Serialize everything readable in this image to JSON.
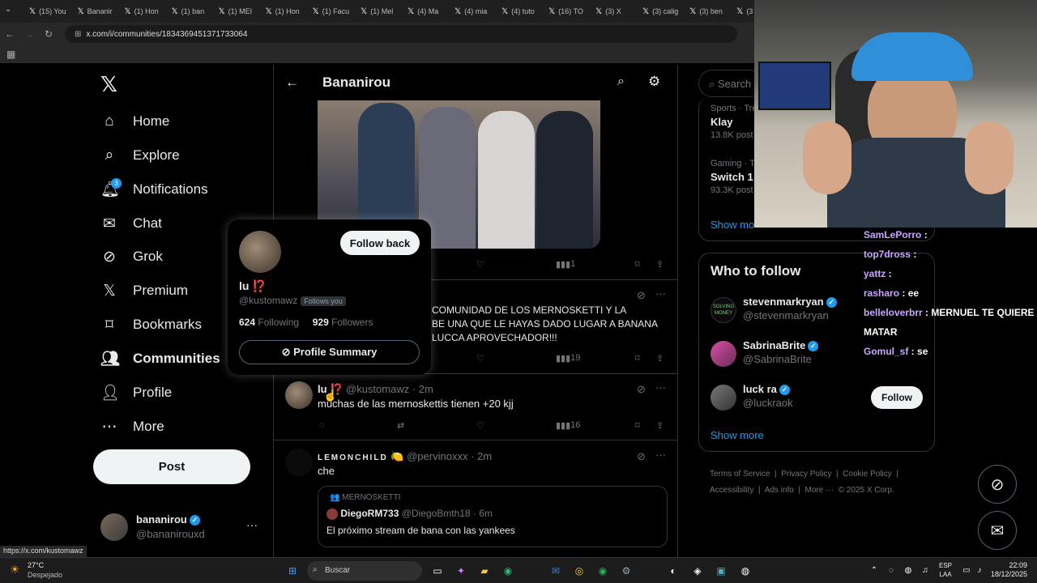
{
  "browser": {
    "tabs": [
      "(15) You",
      "Bananir",
      "(1) Hon",
      "(1) ban",
      "(1) MEI",
      "(1) Hon",
      "(1) Facu",
      "(1) Mel",
      "(4) Ma",
      "(4) mia",
      "(4) tuto",
      "(16) TO",
      "(3) X",
      "(3) calig",
      "(3) ben",
      "(3"
    ],
    "url": "x.com/i/communities/1834369451371733064",
    "status_url": "https://x.com/kustomawz"
  },
  "nav": {
    "items": [
      {
        "label": "Home",
        "icon": "home-icon"
      },
      {
        "label": "Explore",
        "icon": "search-icon"
      },
      {
        "label": "Notifications",
        "icon": "bell-icon",
        "badge": "3"
      },
      {
        "label": "Chat",
        "icon": "mail-icon"
      },
      {
        "label": "Grok",
        "icon": "grok-icon"
      },
      {
        "label": "Premium",
        "icon": "x-icon"
      },
      {
        "label": "Bookmarks",
        "icon": "bookmark-icon"
      },
      {
        "label": "Communities",
        "icon": "people-icon"
      },
      {
        "label": "Profile",
        "icon": "person-icon"
      },
      {
        "label": "More",
        "icon": "more-circle-icon"
      }
    ],
    "post_label": "Post",
    "account": {
      "name": "bananirou",
      "handle": "@bananirouxd"
    }
  },
  "header": {
    "title": "Bananirou"
  },
  "tweets": {
    "first": {
      "views": "1"
    },
    "second": {
      "text1": "COMUNIDAD DE LOS MERNOSKETTI Y LA",
      "text2": "BE UNA QUE LE HAYAS DADO LUGAR A BANANA",
      "text3": "LUCCA APROVECHADOR!!!",
      "views": "19"
    },
    "third": {
      "name": "lu",
      "emoji": "⁉️",
      "handle": "@kustomawz",
      "time": "· 2m",
      "text": "muchas de las mernoskettis tienen +20 kjj",
      "views": "16"
    },
    "fourth": {
      "name": "LEMONCHILD",
      "emoji": "🍋",
      "handle": "@pervinoxxx",
      "time": "· 2m",
      "text": "che",
      "quote": {
        "community": "MERNOSKETTI",
        "name": "DiegoRM733",
        "handle": "@DiegoBmth18",
        "time": "· 6m",
        "text": "El próximo stream de bana con las yankees"
      }
    }
  },
  "hovercard": {
    "follow_back": "Follow back",
    "name": "lu",
    "emoji": "⁉️",
    "handle": "@kustomawz",
    "follows_you": "Follows you",
    "following_count": "624",
    "following_label": "Following",
    "followers_count": "929",
    "followers_label": "Followers",
    "profile_summary": "Profile Summary"
  },
  "right": {
    "search_placeholder": "Search",
    "trends": [
      {
        "category": "Sports · Tre",
        "name": "Klay",
        "posts": "13.8K post"
      },
      {
        "category": "Gaming · Tre",
        "name": "Switch 1",
        "posts": "93.3K post"
      }
    ],
    "show_more_trends": "Show mo",
    "who_to_follow": "Who to follow",
    "suggestions": [
      {
        "name": "stevenmarkryan",
        "handle": "@stevenmarkryan"
      },
      {
        "name": "SabrinaBrite",
        "handle": "@SabrinaBrite"
      },
      {
        "name": "luck ra",
        "handle": "@luckraok",
        "button": "Follow"
      }
    ],
    "show_more": "Show more",
    "footer": [
      "Terms of Service",
      "|",
      "Privacy Policy",
      "|",
      "Cookie Policy",
      "|",
      "Accessibility",
      "|",
      "Ads info",
      "|",
      "More ···",
      "© 2025 X Corp."
    ]
  },
  "chat": [
    {
      "user": "SamLePorro",
      "msg": ""
    },
    {
      "user": "top7dross",
      "msg": ""
    },
    {
      "user": "yattz",
      "msg": ""
    },
    {
      "user": "rasharo",
      "msg": "ee"
    },
    {
      "user": "belleloverbrr",
      "msg": "MERNUEL TE QUIERE MATAR"
    },
    {
      "user": "Gomul_sf",
      "msg": "se"
    }
  ],
  "taskbar": {
    "weather_temp": "27°C",
    "weather_desc": "Despejado",
    "search": "Buscar",
    "lang1": "ESP",
    "lang2": "LAA",
    "time": "22:09",
    "date": "18/12/2025"
  }
}
